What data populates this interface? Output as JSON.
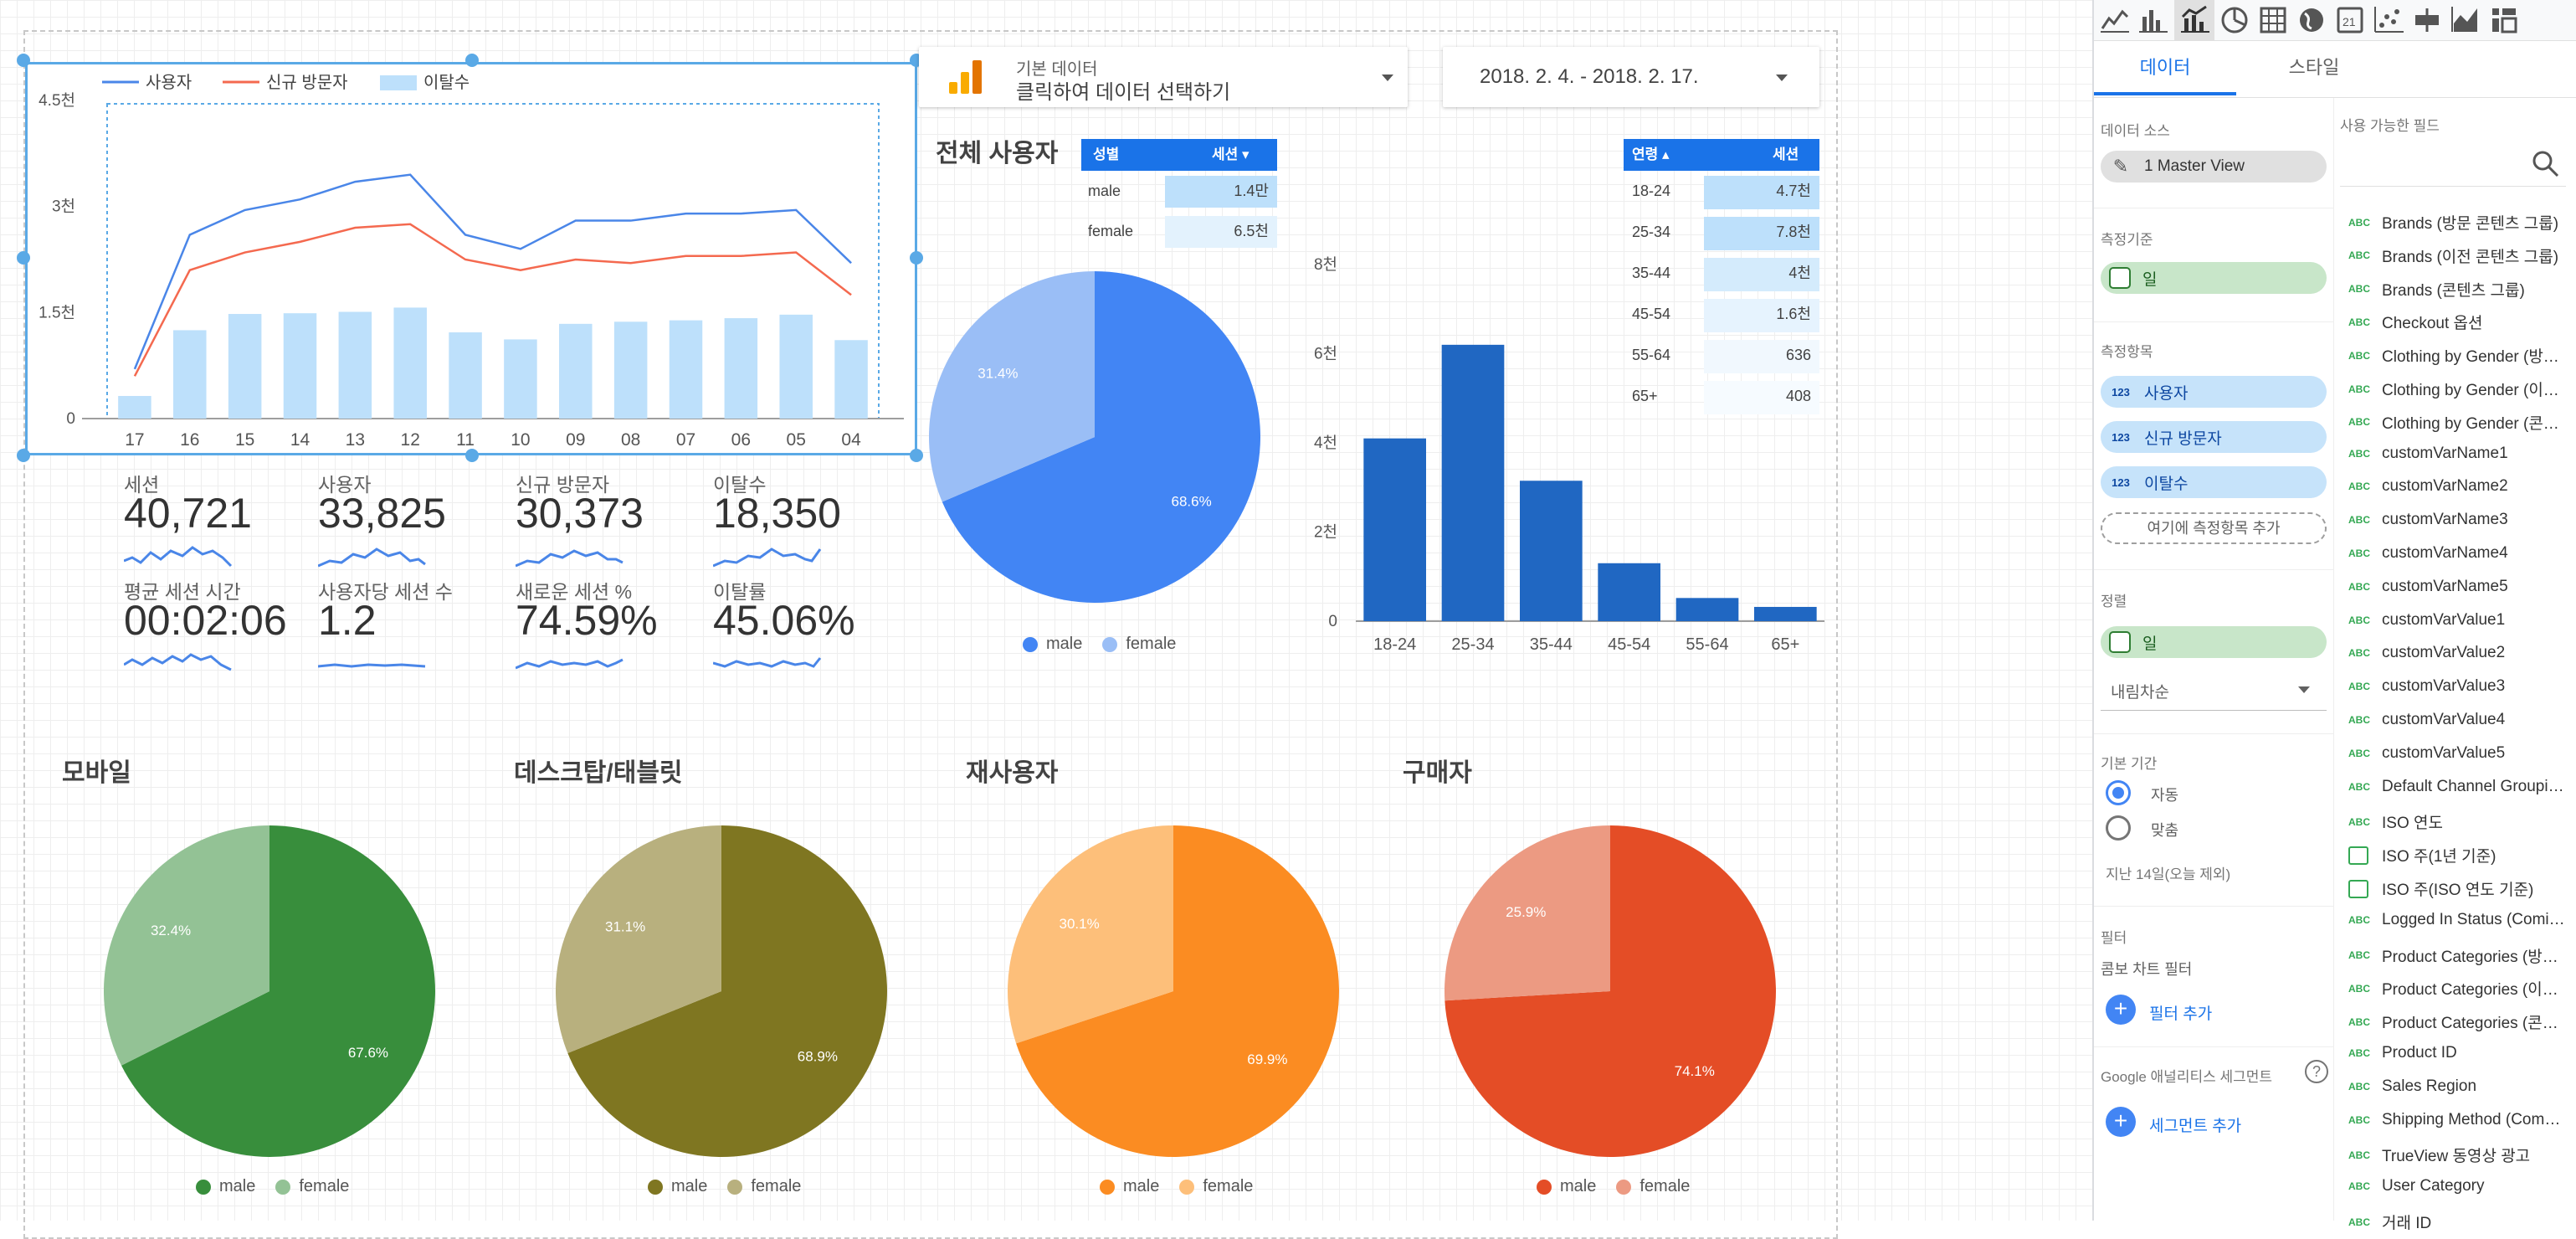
{
  "combo": {
    "legend": [
      "사용자",
      "신규 방문자",
      "이탈수"
    ],
    "y_ticks": [
      "4.5천",
      "3천",
      "1.5천",
      "0"
    ],
    "x_ticks": [
      "17",
      "16",
      "15",
      "14",
      "13",
      "12",
      "11",
      "10",
      "09",
      "08",
      "07",
      "06",
      "05",
      "04"
    ]
  },
  "datasource": {
    "title": "기본 데이터",
    "action": "클릭하여 데이터 선택하기"
  },
  "daterange": {
    "label": "2018. 2. 4. - 2018. 2. 17."
  },
  "scorecards": [
    {
      "label": "세션",
      "value": "40,721"
    },
    {
      "label": "사용자",
      "value": "33,825"
    },
    {
      "label": "신규 방문자",
      "value": "30,373"
    },
    {
      "label": "이탈수",
      "value": "18,350"
    },
    {
      "label": "평균 세션 시간",
      "value": "00:02:06"
    },
    {
      "label": "사용자당 세션 수",
      "value": "1.2"
    },
    {
      "label": "새로운 세션 %",
      "value": "74.59%"
    },
    {
      "label": "이탈률",
      "value": "45.06%"
    }
  ],
  "total_users": {
    "title": "전체 사용자",
    "gender_table": {
      "headers": [
        "성별",
        "세션 ▾"
      ],
      "rows": [
        [
          "male",
          "1.4만"
        ],
        [
          "female",
          "6.5천"
        ]
      ]
    },
    "age_table": {
      "headers": [
        "연령 ▴",
        "세션"
      ],
      "rows": [
        [
          "18-24",
          "4.7천"
        ],
        [
          "25-34",
          "7.8천"
        ],
        [
          "35-44",
          "4천"
        ],
        [
          "45-54",
          "1.6천"
        ],
        [
          "55-64",
          "636"
        ],
        [
          "65+",
          "408"
        ]
      ]
    }
  },
  "legend_male": "male",
  "legend_female": "female",
  "sections": [
    "모바일",
    "데스크탑/태블릿",
    "재사용자",
    "구매자"
  ],
  "chart_data": [
    {
      "type": "bar",
      "title": "",
      "categories": [
        "17",
        "16",
        "15",
        "14",
        "13",
        "12",
        "11",
        "10",
        "09",
        "08",
        "07",
        "06",
        "05",
        "04"
      ],
      "series": [
        {
          "name": "사용자",
          "kind": "line",
          "color": "#4a86e8",
          "values": [
            700,
            2600,
            2950,
            3100,
            3350,
            3450,
            2600,
            2400,
            2800,
            2800,
            2900,
            2900,
            2950,
            2200
          ]
        },
        {
          "name": "신규 방문자",
          "kind": "line",
          "color": "#f4694f",
          "values": [
            600,
            2100,
            2350,
            2500,
            2700,
            2750,
            2250,
            2100,
            2250,
            2200,
            2300,
            2300,
            2350,
            1750
          ]
        },
        {
          "name": "이탈수",
          "kind": "bar",
          "color": "#bde0fb",
          "values": [
            320,
            1250,
            1480,
            1490,
            1510,
            1570,
            1220,
            1120,
            1340,
            1370,
            1390,
            1420,
            1470,
            1110
          ]
        }
      ],
      "ylim": [
        0,
        4500
      ],
      "y_ticks": [
        "4.5천",
        "3천",
        "1.5천",
        "0"
      ]
    },
    {
      "type": "pie",
      "title": "전체 사용자",
      "categories": [
        "male",
        "female"
      ],
      "values": [
        68.6,
        31.4
      ],
      "colors": [
        "#4285f4",
        "#9abef6"
      ]
    },
    {
      "type": "bar",
      "categories": [
        "18-24",
        "25-34",
        "35-44",
        "45-54",
        "55-64",
        "65+"
      ],
      "values": [
        4100,
        6200,
        3150,
        1300,
        520,
        320
      ],
      "ylim": [
        0,
        8000
      ],
      "y_ticks": [
        "8천",
        "6천",
        "4천",
        "2천",
        "0"
      ],
      "color": "#2067c2"
    },
    {
      "type": "pie",
      "title": "모바일",
      "categories": [
        "male",
        "female"
      ],
      "values": [
        67.6,
        32.4
      ],
      "colors": [
        "#388e3c",
        "#93c295"
      ]
    },
    {
      "type": "pie",
      "title": "데스크탑/태블릿",
      "categories": [
        "male",
        "female"
      ],
      "values": [
        68.9,
        31.1
      ],
      "colors": [
        "#7f7621",
        "#b8b07e"
      ]
    },
    {
      "type": "pie",
      "title": "재사용자",
      "categories": [
        "male",
        "female"
      ],
      "values": [
        69.9,
        30.1
      ],
      "colors": [
        "#fb8c22",
        "#fdbf7a"
      ]
    },
    {
      "type": "pie",
      "title": "구매자",
      "categories": [
        "male",
        "female"
      ],
      "values": [
        74.1,
        25.9
      ],
      "colors": [
        "#e44d26",
        "#ec9a82"
      ]
    }
  ],
  "panel": {
    "tabs": [
      "데이터",
      "스타일"
    ],
    "data_source_label": "데이터 소스",
    "data_source": "1 Master View",
    "dimension_label": "측정기준",
    "dimension": "일",
    "metrics_label": "측정항목",
    "metrics": [
      "사용자",
      "신규 방문자",
      "이탈수"
    ],
    "add_metric": "여기에 측정항목 추가",
    "sort_label": "정렬",
    "sort_field": "일",
    "sort_order": "내림차순",
    "period_label": "기본 기간",
    "period_auto": "자동",
    "period_custom": "맞춤",
    "period_note": "지난 14일(오늘 제외)",
    "filter_label": "필터",
    "filter_sub": "콤보 차트 필터",
    "filter_add": "필터 추가",
    "segment_label": "Google 애널리티스 세그먼트",
    "segment_add": "세그먼트 추가",
    "available_fields_label": "사용 가능한 필드",
    "fields": [
      {
        "name": "Brands (방문 콘텐츠 그룹)",
        "type": "abc"
      },
      {
        "name": "Brands (이전 콘텐츠 그룹)",
        "type": "abc"
      },
      {
        "name": "Brands (콘텐츠 그룹)",
        "type": "abc"
      },
      {
        "name": "Checkout 옵션",
        "type": "abc"
      },
      {
        "name": "Clothing by Gender (방…",
        "type": "abc"
      },
      {
        "name": "Clothing by Gender (이…",
        "type": "abc"
      },
      {
        "name": "Clothing by Gender (콘…",
        "type": "abc"
      },
      {
        "name": "customVarName1",
        "type": "abc"
      },
      {
        "name": "customVarName2",
        "type": "abc"
      },
      {
        "name": "customVarName3",
        "type": "abc"
      },
      {
        "name": "customVarName4",
        "type": "abc"
      },
      {
        "name": "customVarName5",
        "type": "abc"
      },
      {
        "name": "customVarValue1",
        "type": "abc"
      },
      {
        "name": "customVarValue2",
        "type": "abc"
      },
      {
        "name": "customVarValue3",
        "type": "abc"
      },
      {
        "name": "customVarValue4",
        "type": "abc"
      },
      {
        "name": "customVarValue5",
        "type": "abc"
      },
      {
        "name": "Default Channel Groupi…",
        "type": "abc"
      },
      {
        "name": "ISO 연도",
        "type": "abc"
      },
      {
        "name": "ISO 주(1년 기준)",
        "type": "date"
      },
      {
        "name": "ISO 주(ISO 연도 기준)",
        "type": "date"
      },
      {
        "name": "Logged In Status (Comi…",
        "type": "abc"
      },
      {
        "name": "Product Categories (방…",
        "type": "abc"
      },
      {
        "name": "Product Categories (이…",
        "type": "abc"
      },
      {
        "name": "Product Categories (콘…",
        "type": "abc"
      },
      {
        "name": "Product ID",
        "type": "abc"
      },
      {
        "name": "Sales Region",
        "type": "abc"
      },
      {
        "name": "Shipping Method (Com…",
        "type": "abc"
      },
      {
        "name": "TrueView 동영상 광고",
        "type": "abc"
      },
      {
        "name": "User Category",
        "type": "abc"
      },
      {
        "name": "거래 ID",
        "type": "abc"
      }
    ],
    "abc_tag": "ABC",
    "num_tag": "123"
  }
}
